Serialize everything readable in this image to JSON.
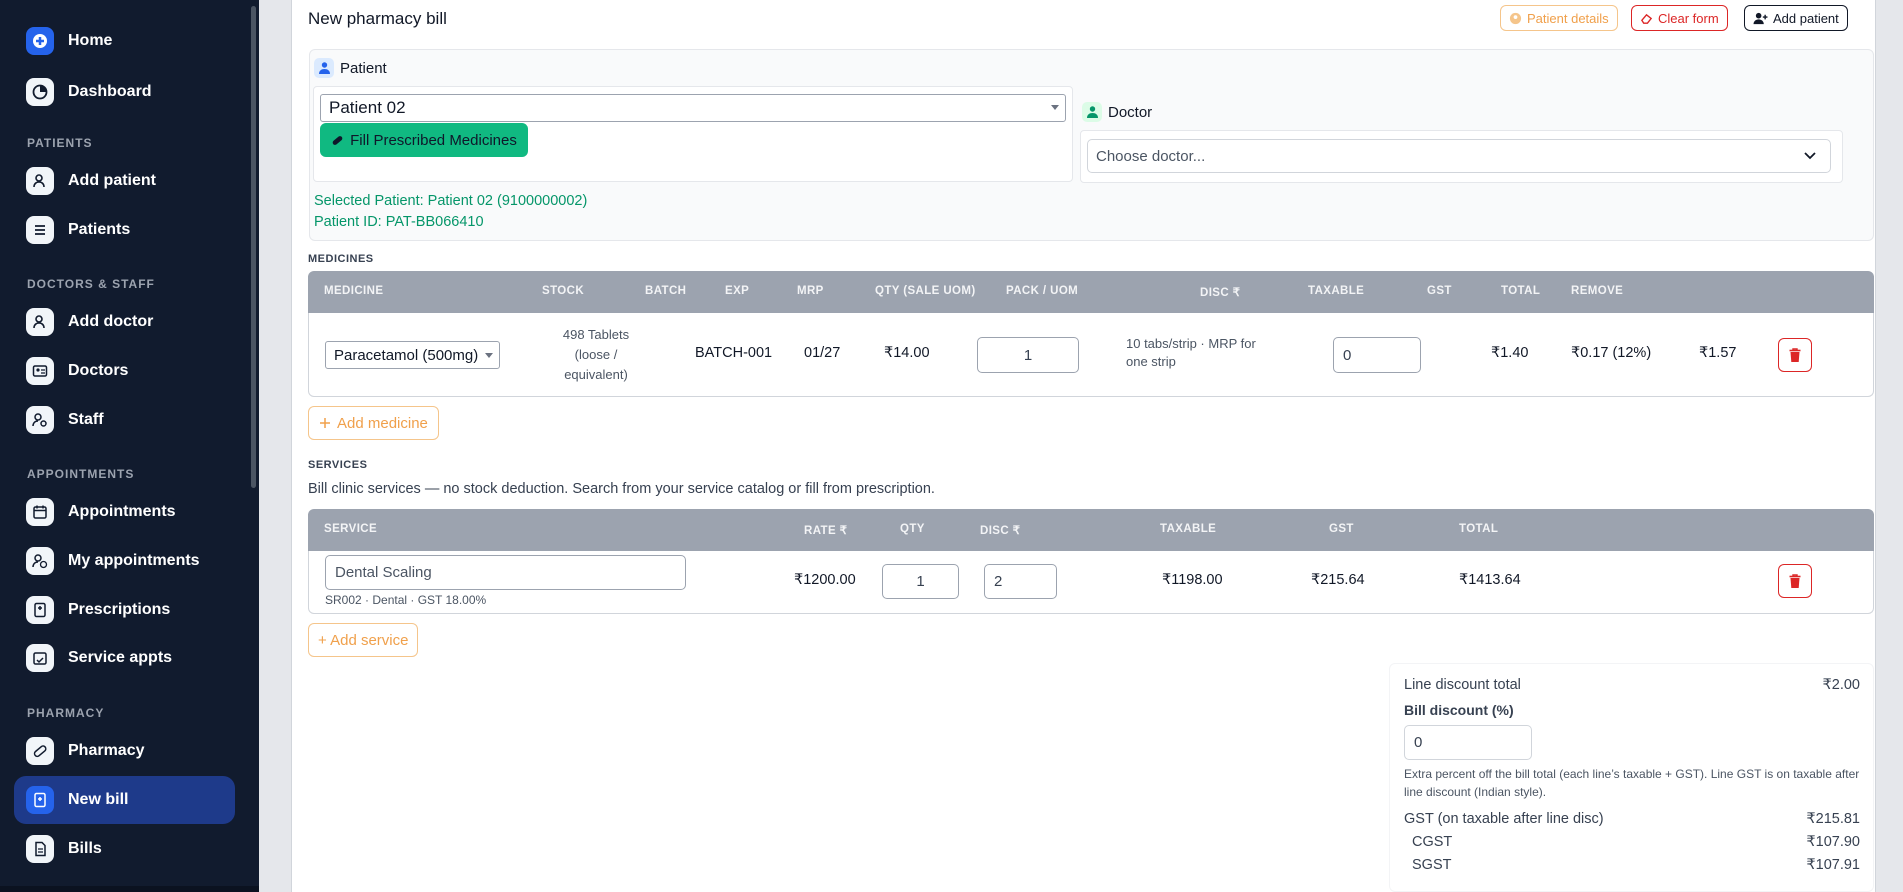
{
  "sidebar": {
    "items": [
      {
        "label": "Home",
        "icon": "home-icon"
      },
      {
        "label": "Dashboard",
        "icon": "pie-chart-icon"
      },
      {
        "label": "Add patient",
        "icon": "user-plus-icon"
      },
      {
        "label": "Patients",
        "icon": "list-icon"
      },
      {
        "label": "Add doctor",
        "icon": "user-plus-icon"
      },
      {
        "label": "Doctors",
        "icon": "id-card-icon"
      },
      {
        "label": "Staff",
        "icon": "user-gear-icon"
      },
      {
        "label": "Appointments",
        "icon": "calendar-icon"
      },
      {
        "label": "My appointments",
        "icon": "user-clock-icon"
      },
      {
        "label": "Prescriptions",
        "icon": "prescription-icon"
      },
      {
        "label": "Service appts",
        "icon": "calendar-check-icon"
      },
      {
        "label": "Pharmacy",
        "icon": "pill-icon"
      },
      {
        "label": "New bill",
        "icon": "prescription-bottle-icon"
      },
      {
        "label": "Bills",
        "icon": "file-icon"
      }
    ],
    "sections": {
      "patients": "PATIENTS",
      "doctors": "DOCTORS & STAFF",
      "appointments": "APPOINTMENTS",
      "pharmacy": "PHARMACY"
    }
  },
  "header": {
    "title": "New pharmacy bill",
    "patient_details": "Patient details",
    "clear_form": "Clear form",
    "add_patient": "Add patient"
  },
  "patient": {
    "label": "Patient",
    "selected_value": "Patient 02",
    "fill_button": "Fill Prescribed Medicines",
    "selected_line_prefix": "Selected Patient: ",
    "selected_line_value": "Patient 02 (9100000002)",
    "id_line_prefix": "Patient ID: ",
    "id_line_value": "PAT-BB066410"
  },
  "doctor": {
    "label": "Doctor",
    "placeholder": "Choose doctor..."
  },
  "medicines": {
    "heading": "MEDICINES",
    "columns": [
      "MEDICINE",
      "STOCK",
      "BATCH",
      "EXP",
      "MRP",
      "QTY (SALE UOM)",
      "PACK / UOM",
      "DISC ₹",
      "TAXABLE",
      "GST",
      "TOTAL",
      "REMOVE"
    ],
    "rows": [
      {
        "medicine": "Paracetamol (500mg)",
        "stock": "498 Tablets (loose / equivalent)",
        "batch": "BATCH-001",
        "exp": "01/27",
        "mrp": "₹14.00",
        "qty": "1",
        "pack": "10 tabs/strip · MRP for one strip",
        "disc": "0",
        "taxable": "₹1.40",
        "gst": "₹0.17 (12%)",
        "total": "₹1.57"
      }
    ],
    "add_button": "Add medicine"
  },
  "services": {
    "heading": "SERVICES",
    "description": "Bill clinic services — no stock deduction. Search from your service catalog or fill from prescription.",
    "columns": [
      "SERVICE",
      "RATE ₹",
      "QTY",
      "DISC ₹",
      "TAXABLE",
      "GST",
      "TOTAL"
    ],
    "rows": [
      {
        "service": "Dental Scaling",
        "meta": "SR002 · Dental · GST 18.00%",
        "rate": "₹1200.00",
        "qty": "1",
        "disc": "2",
        "taxable": "₹1198.00",
        "gst": "₹215.64",
        "total": "₹1413.64"
      }
    ],
    "add_button": "+ Add service"
  },
  "summary": {
    "line_discount_label": "Line discount total",
    "line_discount_value": "₹2.00",
    "bill_discount_label": "Bill discount (%)",
    "bill_discount_value": "0",
    "note": "Extra percent off the bill total (each line’s taxable + GST). Line GST is on taxable after line discount (Indian style).",
    "gst_label": "GST (on taxable after line disc)",
    "gst_value": "₹215.81",
    "cgst_label": "CGST",
    "cgst_value": "₹107.90",
    "sgst_label": "SGST",
    "sgst_value": "₹107.91"
  },
  "colors": {
    "sidebar_bg": "#111b2e",
    "active_nav": "#1e3a8a",
    "accent_green": "#10b981",
    "danger": "#dc2626",
    "warning": "#f0a04b"
  }
}
